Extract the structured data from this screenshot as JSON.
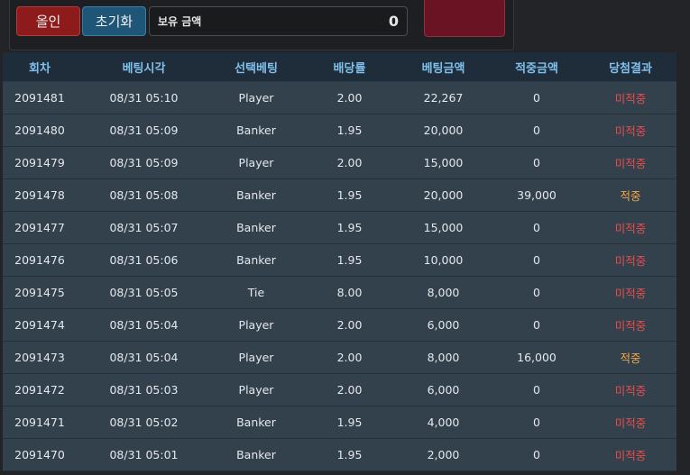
{
  "controls": {
    "allin_label": "올인",
    "reset_label": "초기화",
    "balance_label": "보유 금액",
    "balance_value": "0"
  },
  "colors": {
    "miss": "#e84c4c",
    "hit": "#f0a64a",
    "header_text": "#7fc0ec"
  },
  "table": {
    "headers": [
      "회차",
      "베팅시각",
      "선택베팅",
      "배당률",
      "베팅금액",
      "적중금액",
      "당첨결과"
    ],
    "rows": [
      {
        "round": "2091481",
        "time": "08/31 05:10",
        "pick": "Player",
        "odds": "2.00",
        "bet": "22,267",
        "win": "0",
        "result": "미적중",
        "status": "miss"
      },
      {
        "round": "2091480",
        "time": "08/31 05:09",
        "pick": "Banker",
        "odds": "1.95",
        "bet": "20,000",
        "win": "0",
        "result": "미적중",
        "status": "miss"
      },
      {
        "round": "2091479",
        "time": "08/31 05:09",
        "pick": "Player",
        "odds": "2.00",
        "bet": "15,000",
        "win": "0",
        "result": "미적중",
        "status": "miss"
      },
      {
        "round": "2091478",
        "time": "08/31 05:08",
        "pick": "Banker",
        "odds": "1.95",
        "bet": "20,000",
        "win": "39,000",
        "result": "적중",
        "status": "hit"
      },
      {
        "round": "2091477",
        "time": "08/31 05:07",
        "pick": "Banker",
        "odds": "1.95",
        "bet": "15,000",
        "win": "0",
        "result": "미적중",
        "status": "miss"
      },
      {
        "round": "2091476",
        "time": "08/31 05:06",
        "pick": "Banker",
        "odds": "1.95",
        "bet": "10,000",
        "win": "0",
        "result": "미적중",
        "status": "miss"
      },
      {
        "round": "2091475",
        "time": "08/31 05:05",
        "pick": "Tie",
        "odds": "8.00",
        "bet": "8,000",
        "win": "0",
        "result": "미적중",
        "status": "miss"
      },
      {
        "round": "2091474",
        "time": "08/31 05:04",
        "pick": "Player",
        "odds": "2.00",
        "bet": "6,000",
        "win": "0",
        "result": "미적중",
        "status": "miss"
      },
      {
        "round": "2091473",
        "time": "08/31 05:04",
        "pick": "Player",
        "odds": "2.00",
        "bet": "8,000",
        "win": "16,000",
        "result": "적중",
        "status": "hit"
      },
      {
        "round": "2091472",
        "time": "08/31 05:03",
        "pick": "Player",
        "odds": "2.00",
        "bet": "6,000",
        "win": "0",
        "result": "미적중",
        "status": "miss"
      },
      {
        "round": "2091471",
        "time": "08/31 05:02",
        "pick": "Banker",
        "odds": "1.95",
        "bet": "4,000",
        "win": "0",
        "result": "미적중",
        "status": "miss"
      },
      {
        "round": "2091470",
        "time": "08/31 05:01",
        "pick": "Banker",
        "odds": "1.95",
        "bet": "2,000",
        "win": "0",
        "result": "미적중",
        "status": "miss"
      }
    ]
  }
}
